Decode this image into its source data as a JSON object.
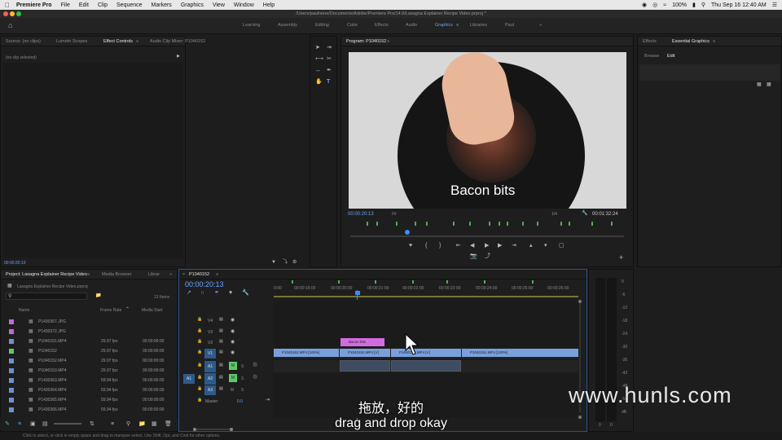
{
  "menubar": {
    "app": "Premiere Pro",
    "items": [
      "File",
      "Edit",
      "Clip",
      "Sequence",
      "Markers",
      "Graphics",
      "View",
      "Window",
      "Help"
    ],
    "battery": "100%",
    "clock": "Thu Sep 16  12:40 AM"
  },
  "titlebar": {
    "path": "/Users/paulnene/Documents/Adobe/Premiere Pro/14.0/Lasagna Explainer Recipe Video.prproj *"
  },
  "workspaces": {
    "items": [
      "Learning",
      "Assembly",
      "Editing",
      "Color",
      "Effects",
      "Audio",
      "Graphics",
      "Libraries",
      "Paul"
    ],
    "active": "Graphics",
    "more": "»"
  },
  "source_panel": {
    "tabs": [
      "Source: (no clips)",
      "Lumetri Scopes",
      "Effect Controls",
      "Audio Clip Mixer: P1040152"
    ],
    "no_clip": "(no clip selected)",
    "timecode": "00:00:20:13"
  },
  "program": {
    "title": "Program: P1040152",
    "timecode": "00:00:20:13",
    "fit": "Fit",
    "quality": "1/4",
    "duration": "00:01:32:24",
    "overlay": "Bacon bits"
  },
  "essential": {
    "tabs": [
      "Effects",
      "Essential Graphics"
    ],
    "subtabs": [
      "Browse",
      "Edit"
    ]
  },
  "project": {
    "tabs": [
      "Project: Lasagna Explainer Recipe Video",
      "Media Browser",
      "Librar"
    ],
    "file": "Lasagna Explainer Recipe Video.prproj",
    "count": "13 Items",
    "headers": {
      "name": "Name",
      "frame_rate": "Frame Rate",
      "media_start": "Media Start"
    },
    "rows": [
      {
        "name": "P1430367.JPG",
        "fps": "",
        "start": "",
        "color": "#c06ad6"
      },
      {
        "name": "P1430372.JPG",
        "fps": "",
        "start": "",
        "color": "#c06ad6"
      },
      {
        "name": "P1040151.MP4",
        "fps": "29.97 fps",
        "start": "00:00:00:00",
        "color": "#6f8fd0"
      },
      {
        "name": "P1040152",
        "fps": "29.97 fps",
        "start": "00:00:00:00",
        "color": "#5fc86a"
      },
      {
        "name": "P1040152.MP4",
        "fps": "29.97 fps",
        "start": "00:00:00:00",
        "color": "#6f8fd0"
      },
      {
        "name": "P1040153.MP4",
        "fps": "29.97 fps",
        "start": "00:00:00:00",
        "color": "#6f8fd0"
      },
      {
        "name": "P1430363.MP4",
        "fps": "59.94 fps",
        "start": "00:00:00:00",
        "color": "#6f8fd0"
      },
      {
        "name": "P1430364.MP4",
        "fps": "59.94 fps",
        "start": "00:00:00:00",
        "color": "#6f8fd0"
      },
      {
        "name": "P1430365.MP4",
        "fps": "59.94 fps",
        "start": "00:00:00:00",
        "color": "#6f8fd0"
      },
      {
        "name": "P1430366.MP4",
        "fps": "59.94 fps",
        "start": "00:00:00:00",
        "color": "#6f8fd0"
      }
    ]
  },
  "timeline": {
    "name": "P1040152",
    "timecode": "00:00:20:13",
    "ruler": [
      "0:00",
      "00:00:19:00",
      "00:00:20:00",
      "00:00:21:00",
      "00:00:22:00",
      "00:00:23:00",
      "00:00:24:00",
      "00:00:25:00",
      "00:00:26:00"
    ],
    "tracks": {
      "v4": "V4",
      "v3": "V3",
      "v2": "V2",
      "v1": "V1",
      "a1": "A1",
      "a2": "A2",
      "a3": "A3",
      "src_a1": "A1",
      "master": "Master",
      "master_val": "0.0"
    },
    "clips": {
      "bacon": "Bacon bits",
      "c1": "P1040152.MP4 [V]",
      "c2": "P1040152.MP4 [V]",
      "c3": "P1040152.MP4 [V]",
      "c4": "P1040151.MP4 [100%]",
      "c5": "P1040152.MP4 [100%]"
    }
  },
  "meter": {
    "ticks": [
      "0",
      "-6",
      "-12",
      "-18",
      "-24",
      "-30",
      "-36",
      "-42",
      "-48",
      "-54",
      "dB"
    ],
    "bottom": [
      "0",
      "0"
    ]
  },
  "status": "Click to select, or click in empty space and drag to marquee select. Use Shift, Opt, and Cmd for other options.",
  "subtitles": {
    "cn": "拖放，好的",
    "en": "drag and drop okay"
  },
  "watermark": "www.hunls.com"
}
